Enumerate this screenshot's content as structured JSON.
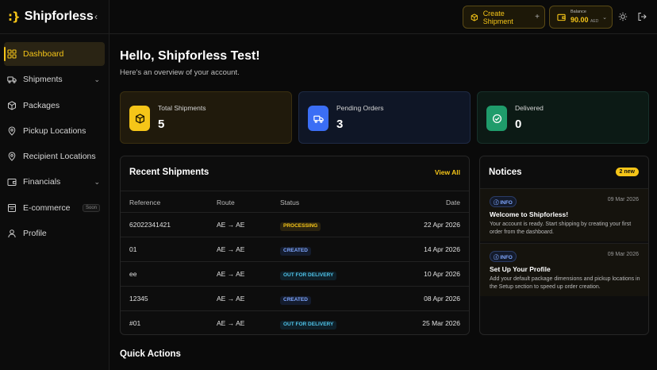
{
  "brand": {
    "logo": ":}",
    "name": "Shipforless",
    "collapse_icon": "chevron-left-icon"
  },
  "sidebar": {
    "items": [
      {
        "label": "Dashboard",
        "icon": "grid-icon",
        "active": true
      },
      {
        "label": "Shipments",
        "icon": "truck-icon",
        "chevron": "⌄"
      },
      {
        "label": "Packages",
        "icon": "box-icon"
      },
      {
        "label": "Pickup Locations",
        "icon": "map-pin-icon"
      },
      {
        "label": "Recipient Locations",
        "icon": "map-pin-icon"
      },
      {
        "label": "Financials",
        "icon": "wallet-icon",
        "chevron": "⌄"
      },
      {
        "label": "E-commerce",
        "icon": "store-icon",
        "badge": "Soon"
      },
      {
        "label": "Profile",
        "icon": "user-icon"
      }
    ]
  },
  "topbar": {
    "create_label": "Create Shipment",
    "create_plus": "+",
    "balance_label": "Balance",
    "balance_amount": "90.00",
    "balance_currency": "AED"
  },
  "greeting": {
    "title": "Hello, Shipforless Test!",
    "subtitle": "Here's an overview of your account."
  },
  "stats": [
    {
      "label": "Total Shipments",
      "value": "5",
      "color": "#f5c518"
    },
    {
      "label": "Pending Orders",
      "value": "3",
      "color": "#3b6ef5"
    },
    {
      "label": "Delivered",
      "value": "0",
      "color": "#1f9c6b"
    }
  ],
  "shipments": {
    "title": "Recent Shipments",
    "view_all": "View All",
    "columns": [
      "Reference",
      "Route",
      "Status",
      "Date"
    ],
    "rows": [
      {
        "ref": "62022341421",
        "route": "AE → AE",
        "status": "PROCESSING",
        "date": "22 Apr 2026"
      },
      {
        "ref": "01",
        "route": "AE → AE",
        "status": "CREATED",
        "date": "14 Apr 2026"
      },
      {
        "ref": "ee",
        "route": "AE → AE",
        "status": "OUT FOR DELIVERY",
        "date": "10 Apr 2026"
      },
      {
        "ref": "12345",
        "route": "AE → AE",
        "status": "CREATED",
        "date": "08 Apr 2026"
      },
      {
        "ref": "#01",
        "route": "AE → AE",
        "status": "OUT FOR DELIVERY",
        "date": "25 Mar 2026"
      }
    ]
  },
  "notices": {
    "title": "Notices",
    "badge": "2 new",
    "items": [
      {
        "tag": "INFO",
        "date": "09 Mar 2026",
        "title": "Welcome to Shipforless!",
        "body": "Your account is ready. Start shipping by creating your first order from the dashboard."
      },
      {
        "tag": "INFO",
        "date": "09 Mar 2026",
        "title": "Set Up Your Profile",
        "body": "Add your default package dimensions and pickup locations in the Setup section to speed up order creation."
      }
    ]
  },
  "quick_actions": {
    "title": "Quick Actions"
  }
}
